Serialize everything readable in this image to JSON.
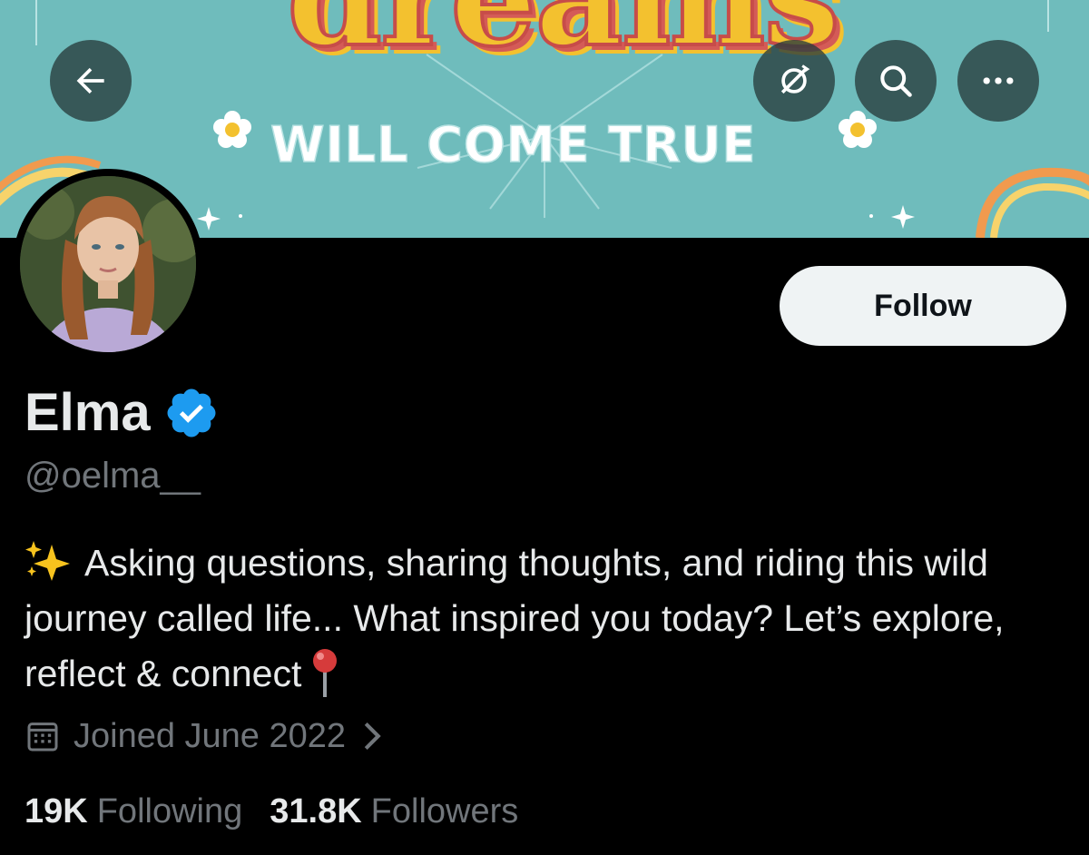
{
  "banner": {
    "headline": "dreams",
    "subline": "WILL COME TRUE"
  },
  "nav": {
    "back_icon": "arrow-left-icon",
    "refresh_icon": "refresh-icon",
    "search_icon": "search-icon",
    "more_icon": "more-horizontal-icon"
  },
  "profile": {
    "display_name": "Elma",
    "verified": true,
    "handle": "@oelma__",
    "bio_text": "Asking questions, sharing thoughts, and riding this wild journey called life... What inspired you today? Let’s explore, reflect & connect",
    "joined": "Joined June 2022",
    "follow_label": "Follow"
  },
  "stats": {
    "following_count": "19K",
    "following_label": "Following",
    "followers_count": "31.8K",
    "followers_label": "Followers"
  },
  "colors": {
    "background": "#000000",
    "primary_text": "#e7e9ea",
    "secondary_text": "#71767b",
    "verified_blue": "#1d9bf0",
    "follow_button_bg": "#eff3f4",
    "banner_teal": "#6fbcbc"
  }
}
